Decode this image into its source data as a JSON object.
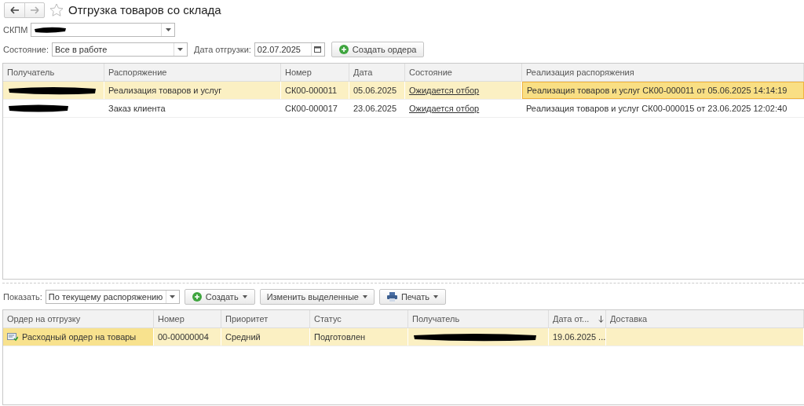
{
  "window": {
    "title": "Отгрузка товаров со склада",
    "favorite": false
  },
  "filters": {
    "warehouse": {
      "label": "СКПМ",
      "redacted": true
    },
    "state": {
      "label": "Состояние:",
      "value": "Все в работе"
    },
    "date": {
      "label": "Дата отгрузки:",
      "value": "02.07.2025"
    },
    "create_button": "Создать ордера"
  },
  "orders_table": {
    "columns": [
      {
        "label": "Получатель"
      },
      {
        "label": "Распоряжение"
      },
      {
        "label": "Номер"
      },
      {
        "label": "Дата"
      },
      {
        "label": "Состояние"
      },
      {
        "label": "Реализация распоряжения"
      }
    ],
    "rows": [
      {
        "selected": true,
        "cells": [
          {
            "kind": "redacted",
            "focused": false
          },
          {
            "kind": "text",
            "text": "Реализация товаров и услуг",
            "focused": false
          },
          {
            "kind": "text",
            "text": "СК00-000011",
            "focused": false
          },
          {
            "kind": "text",
            "text": "05.06.2025",
            "focused": false
          },
          {
            "kind": "link",
            "text": "Ожидается отбор",
            "focused": false
          },
          {
            "kind": "text",
            "text": "Реализация товаров и услуг СК00-000011 от 05.06.2025 14:14:19",
            "focused": true
          }
        ]
      },
      {
        "selected": false,
        "cells": [
          {
            "kind": "redacted",
            "focused": false
          },
          {
            "kind": "text",
            "text": "Заказ клиента",
            "focused": false
          },
          {
            "kind": "text",
            "text": "СК00-000017",
            "focused": false
          },
          {
            "kind": "text",
            "text": "23.06.2025",
            "focused": false
          },
          {
            "kind": "link",
            "text": "Ожидается отбор",
            "focused": false
          },
          {
            "kind": "text",
            "text": "Реализация товаров и услуг СК00-000015 от 23.06.2025 12:02:40",
            "focused": false
          }
        ]
      }
    ]
  },
  "toolbar": {
    "show_label": "Показать:",
    "show_value": "По текущему распоряжению",
    "buttons": [
      {
        "label": "Создать",
        "kind": "add",
        "dropdown": true
      },
      {
        "label": "Изменить выделенные",
        "kind": "plain",
        "dropdown": true
      },
      {
        "label": "Печать",
        "kind": "print",
        "dropdown": true
      }
    ]
  },
  "shipment_table": {
    "columns": [
      {
        "label": "Ордер на отгрузку",
        "sorted": false
      },
      {
        "label": "Номер",
        "sorted": false
      },
      {
        "label": "Приоритет",
        "sorted": false
      },
      {
        "label": "Статус",
        "sorted": false
      },
      {
        "label": "Получатель",
        "sorted": false
      },
      {
        "label": "Дата от...",
        "sorted": true
      },
      {
        "label": "Доставка",
        "sorted": false
      }
    ],
    "rows": [
      {
        "selected": true,
        "cells": [
          {
            "kind": "document",
            "text": "Расходный ордер на товары",
            "focused": true
          },
          {
            "kind": "text",
            "text": "00-00000004",
            "focused": false
          },
          {
            "kind": "text",
            "text": "Средний",
            "focused": false
          },
          {
            "kind": "text",
            "text": "Подготовлен",
            "focused": false
          },
          {
            "kind": "redacted",
            "focused": false
          },
          {
            "kind": "text",
            "text": "19.06.2025 ...",
            "focused": false
          },
          {
            "kind": "empty",
            "focused": false
          }
        ]
      }
    ]
  }
}
